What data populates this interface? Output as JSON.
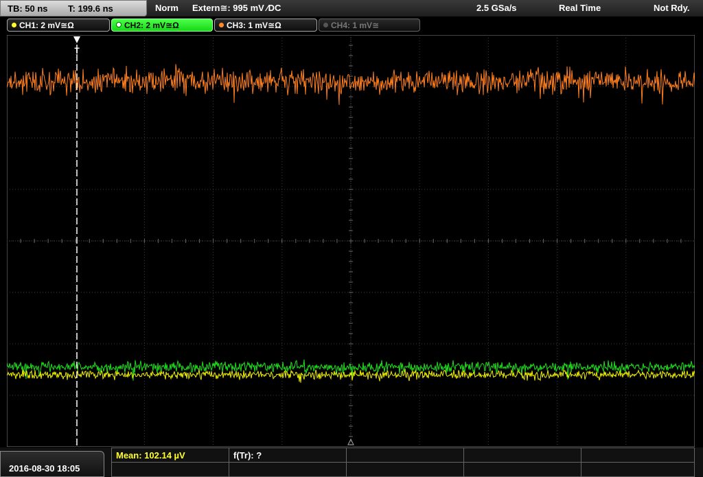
{
  "topbar": {
    "timebase": "TB: 50 ns",
    "trigger_time": "T: 199.6 ns",
    "mode": "Norm",
    "trigger_source": "Extern≅: 995 mV ⁄DC",
    "sample_rate": "2.5 GSa/s",
    "acq_mode": "Real Time",
    "status": "Not Rdy."
  },
  "channels": [
    {
      "id": "ch1",
      "label": "CH1: 2 mV≅Ω",
      "color": "#ffff2a",
      "active": false
    },
    {
      "id": "ch2",
      "label": "CH2: 2 mV≅Ω",
      "color": "#20e020",
      "active": true
    },
    {
      "id": "ch3",
      "label": "CH3: 1 mV≅Ω",
      "color": "#ff8c2a",
      "active": false
    },
    {
      "id": "ch4",
      "label": "CH4: 1 mV≅",
      "color": "#777777",
      "active": false
    }
  ],
  "waveform": {
    "trigger_marker": "T",
    "traces": [
      {
        "name": "ch3",
        "color": "#ff7f1e",
        "baseline_div": 0.9,
        "noise_div": 0.25
      },
      {
        "name": "ch2",
        "color": "#1ee01e",
        "baseline_div": 6.45,
        "noise_div": 0.11
      },
      {
        "name": "ch1",
        "color": "#f0f000",
        "baseline_div": 6.6,
        "noise_div": 0.09
      }
    ]
  },
  "bottombar": {
    "datetime": "2016-08-30 18:05",
    "measurement_mean": "Mean: 102.14 µV",
    "measurement_ftr": "f(Tr): ?",
    "mean_color": "#ffff2a"
  }
}
